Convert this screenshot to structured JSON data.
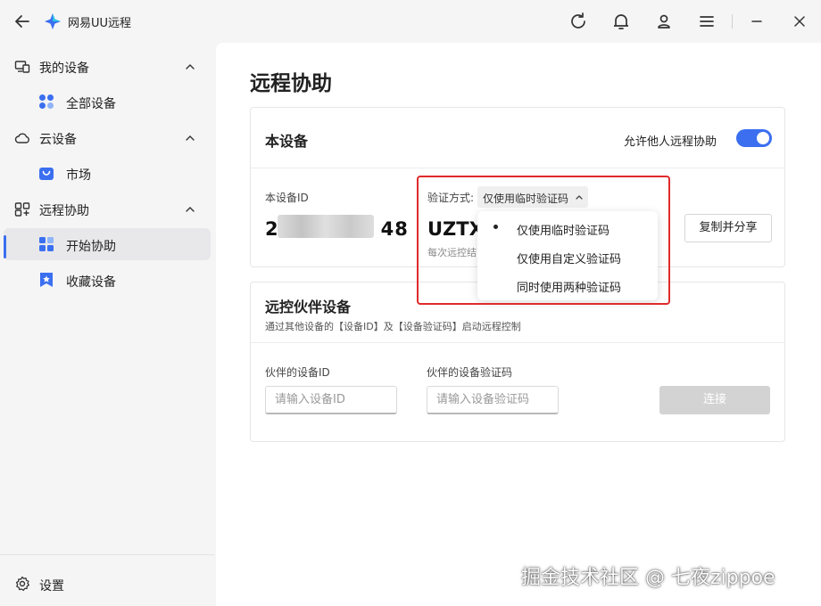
{
  "titlebar": {
    "app_name": "网易UU远程"
  },
  "sidebar": {
    "groups": [
      {
        "label": "我的设备",
        "items": [
          {
            "label": "全部设备"
          }
        ]
      },
      {
        "label": "云设备",
        "items": [
          {
            "label": "市场"
          }
        ]
      },
      {
        "label": "远程协助",
        "items": [
          {
            "label": "开始协助",
            "active": true
          },
          {
            "label": "收藏设备"
          }
        ]
      }
    ],
    "settings_label": "设置"
  },
  "main": {
    "title": "远程协助",
    "this_device": {
      "title": "本设备",
      "allow_label": "允许他人远程协助",
      "allow_enabled": true,
      "device_id_label": "本设备ID",
      "device_id_prefix": "2",
      "device_id_suffix": "48",
      "verify_label": "验证方式:",
      "verify_selected": "仅使用临时验证码",
      "code": "UZTX",
      "code_hint": "每次远控结",
      "copy_button": "复制并分享"
    },
    "partner": {
      "title": "远控伙伴设备",
      "subtitle": "通过其他设备的【设备ID】及【设备验证码】启动远程控制",
      "id_label": "伙伴的设备ID",
      "id_placeholder": "请输入设备ID",
      "code_label": "伙伴的设备验证码",
      "code_placeholder": "请输入设备验证码",
      "connect_button": "连接"
    }
  },
  "dropdown": {
    "options": [
      {
        "label": "仅使用临时验证码",
        "selected": true
      },
      {
        "label": "仅使用自定义验证码",
        "selected": false
      },
      {
        "label": "同时使用两种验证码",
        "selected": false
      }
    ]
  },
  "watermark": "掘金技术社区 @ 七夜zippoe",
  "colors": {
    "accent": "#3b6ff0",
    "highlight": "#e02a2a"
  }
}
